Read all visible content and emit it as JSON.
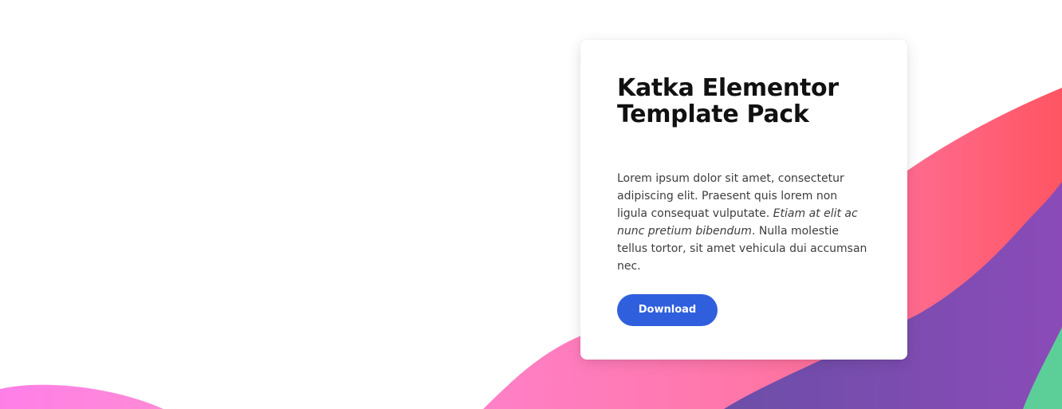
{
  "card": {
    "title_line1": "Katka Elementor",
    "title_line2": "Template Pack",
    "paragraph": {
      "part1": "Lorem ipsum dolor sit amet, consectetur adipiscing elit. Praesent quis lorem non ligula consequat vulputate. ",
      "emphasis": "Etiam at elit ac nunc pretium bibendum",
      "part2": ". Nulla molestie tellus tortor, sit amet vehicula dui accumsan nec."
    },
    "button_label": "Download"
  },
  "colors": {
    "button": "#2f5fdc",
    "wave_pink": "#ff7fb6",
    "wave_red": "#ff5a6e",
    "wave_purple": "#7b4fb0",
    "wave_green": "#5ccf98",
    "wave_magenta": "#ff80e6"
  }
}
